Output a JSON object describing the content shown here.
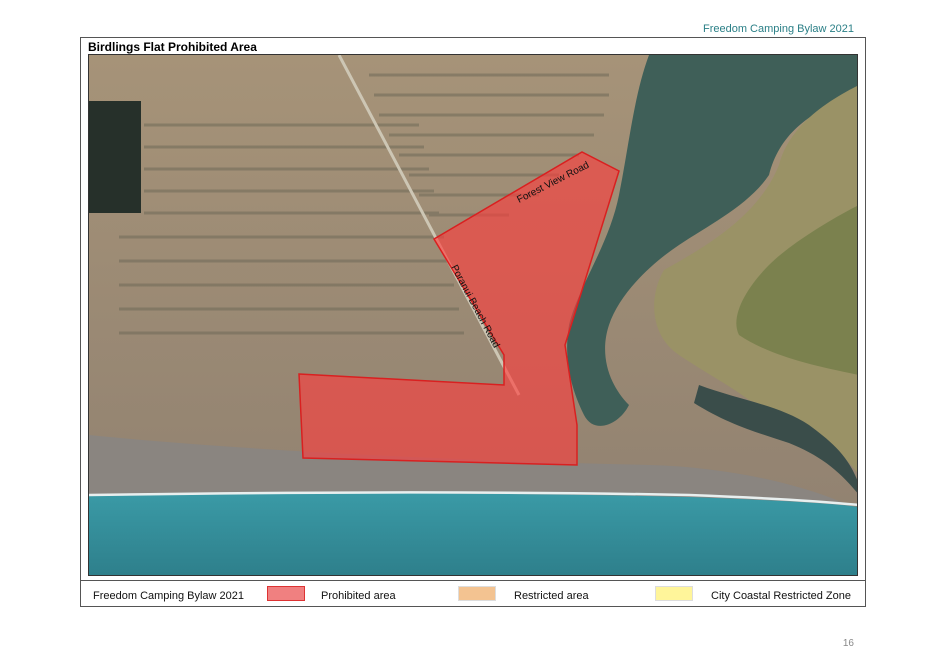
{
  "header": {
    "document_title": "Freedom Camping Bylaw 2021"
  },
  "map": {
    "title": "Birdlings Flat Prohibited Area",
    "road_labels": [
      "Forest View Road",
      "Poranui Beach Road"
    ]
  },
  "legend": {
    "bylaw_label": "Freedom Camping Bylaw 2021",
    "items": [
      {
        "label": "Prohibited area",
        "color": "#f08080"
      },
      {
        "label": "Restricted area",
        "color": "#f3c391"
      },
      {
        "label": "City Coastal Restricted Zone",
        "color": "#fff59a"
      }
    ]
  },
  "footer": {
    "page_number": "16"
  }
}
